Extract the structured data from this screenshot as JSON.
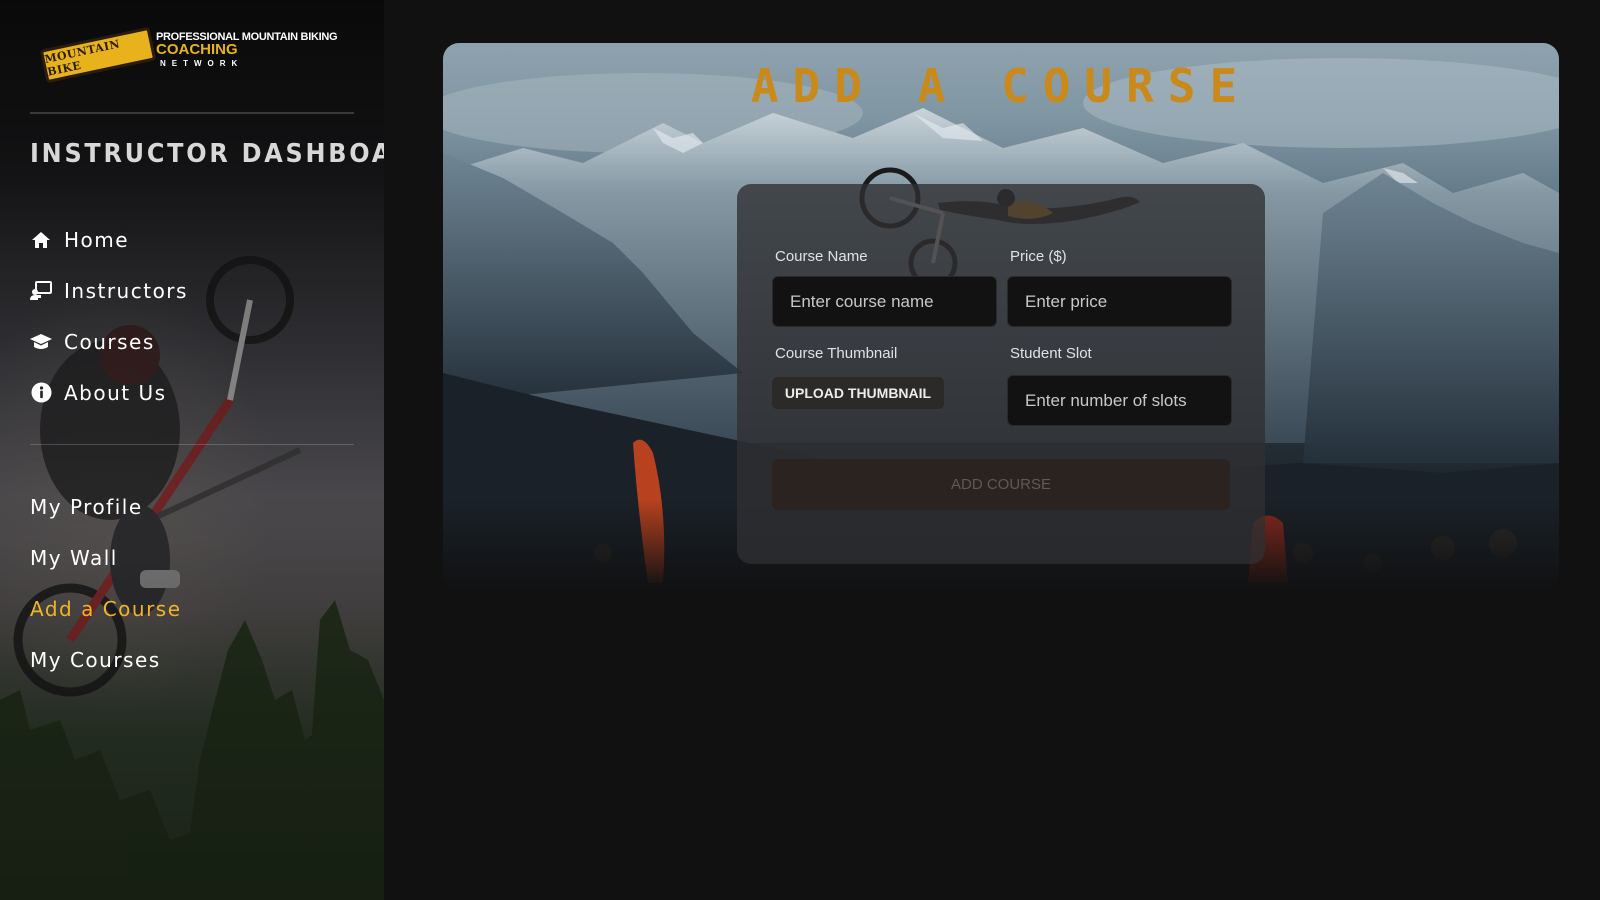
{
  "brand": {
    "badge_text": "MOUNTAIN BIKE",
    "line1": "PROFESSIONAL MOUNTAIN BIKING",
    "line2": "COACHING",
    "line3": "NETWORK"
  },
  "sidebar": {
    "title": "INSTRUCTOR DASHBOARD",
    "nav": [
      {
        "label": "Home",
        "icon": "home-icon"
      },
      {
        "label": "Instructors",
        "icon": "instructor-board-icon"
      },
      {
        "label": "Courses",
        "icon": "graduation-cap-icon"
      },
      {
        "label": "About Us",
        "icon": "info-icon"
      }
    ],
    "subnav": [
      {
        "label": "My Profile"
      },
      {
        "label": "My Wall"
      },
      {
        "label": "Add a Course",
        "active": true
      },
      {
        "label": "My Courses"
      }
    ],
    "active_color": "#f0b429"
  },
  "main": {
    "title": "ADD A COURSE",
    "title_color": "#c98a1b",
    "form": {
      "course_name": {
        "label": "Course Name",
        "placeholder": "Enter course name",
        "value": ""
      },
      "price": {
        "label": "Price ($)",
        "placeholder": "Enter price",
        "value": ""
      },
      "thumbnail": {
        "label": "Course Thumbnail",
        "button": "UPLOAD THUMBNAIL"
      },
      "slots": {
        "label": "Student Slot",
        "placeholder": "Enter number of slots",
        "value": ""
      },
      "submit": "ADD COURSE"
    }
  }
}
